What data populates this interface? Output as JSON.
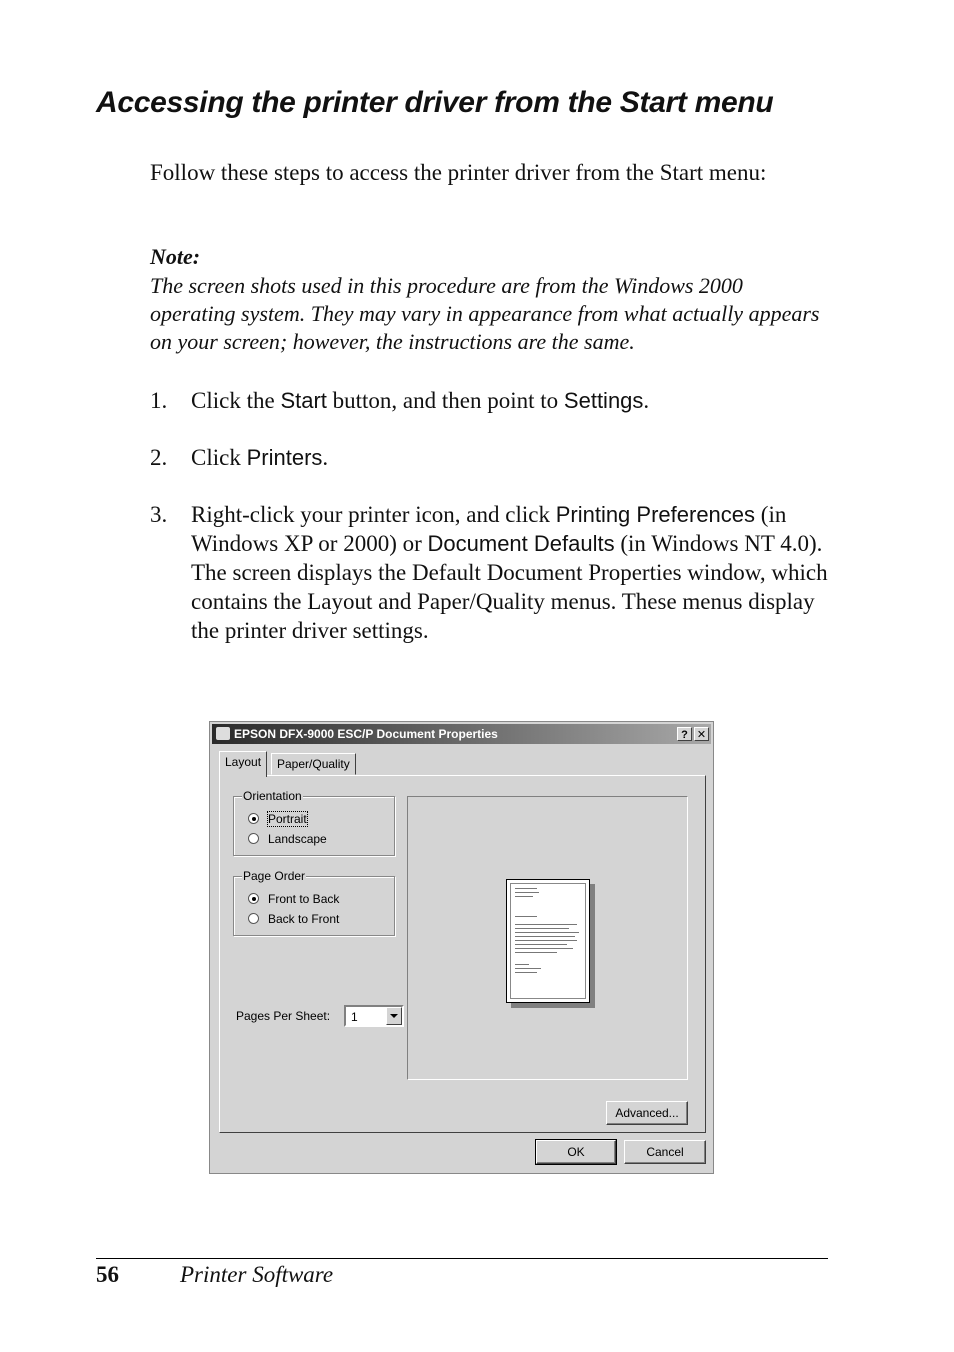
{
  "heading": "Accessing the printer driver from the Start menu",
  "intro": "Follow these steps to access the printer driver from the Start menu:",
  "note": {
    "title": "Note:",
    "body": "The screen shots used in this procedure are from the Windows 2000 operating system. They may vary in appearance from what actually appears on your screen; however, the instructions are the same."
  },
  "steps": [
    {
      "num": "1.",
      "parts": [
        "Click the ",
        "Start",
        " button, and then point to ",
        "Settings",
        "."
      ]
    },
    {
      "num": "2.",
      "parts": [
        "Click ",
        "Printers",
        "."
      ]
    },
    {
      "num": "3.",
      "parts": [
        "Right-click your printer icon, and click ",
        "Printing Preferences",
        " (in Windows XP or 2000) or ",
        "Document Defaults",
        " (in Windows NT 4.0). The screen displays the Default Document Properties window, which contains the Layout and Paper/Quality menus. These menus display the printer driver settings."
      ]
    }
  ],
  "dialog": {
    "title": "EPSON DFX-9000 ESC/P Document Properties",
    "help_btn": "?",
    "close_btn": "✕",
    "tabs": [
      {
        "label": "Layout",
        "active": true
      },
      {
        "label": "Paper/Quality",
        "active": false
      }
    ],
    "orientation": {
      "legend": "Orientation",
      "options": [
        {
          "label": "Portrait",
          "selected": true
        },
        {
          "label": "Landscape",
          "selected": false
        }
      ]
    },
    "page_order": {
      "legend": "Page Order",
      "options": [
        {
          "label": "Front to Back",
          "selected": true
        },
        {
          "label": "Back to Front",
          "selected": false
        }
      ]
    },
    "pages_per_sheet": {
      "label": "Pages Per Sheet:",
      "value": "1"
    },
    "advanced_btn": "Advanced...",
    "ok_btn": "OK",
    "cancel_btn": "Cancel"
  },
  "footer": {
    "page_number": "56",
    "section": "Printer Software"
  }
}
